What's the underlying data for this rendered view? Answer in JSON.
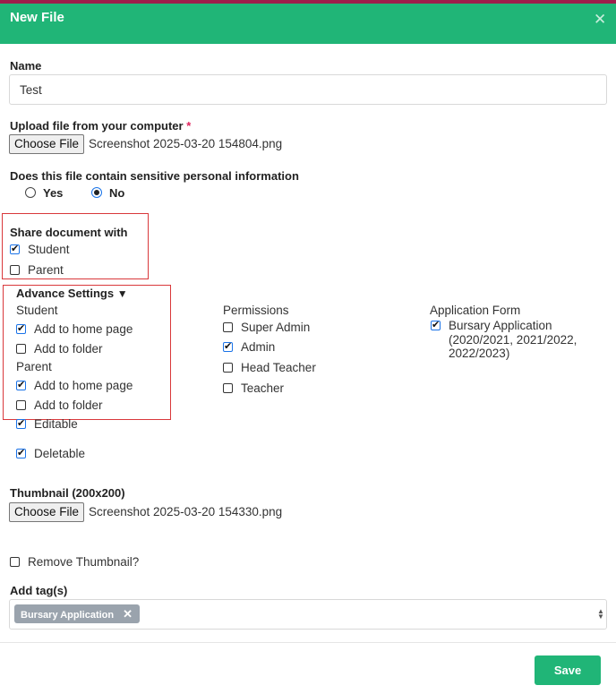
{
  "dialog": {
    "title": "New File",
    "close_glyph": "✕"
  },
  "name_field": {
    "label": "Name",
    "value": "Test"
  },
  "upload": {
    "label": "Upload file from your computer",
    "required_mark": "*",
    "button": "Choose File",
    "filename": "Screenshot 2025-03-20 154804.png"
  },
  "sensitive": {
    "question": "Does this file contain sensitive personal information",
    "yes": "Yes",
    "no": "No",
    "selected": "No"
  },
  "share": {
    "title": "Share document with",
    "student": "Student",
    "student_checked": true,
    "parent": "Parent",
    "parent_checked": false
  },
  "advance": {
    "title": "Advance Settings",
    "toggle_glyph": "▼",
    "student_heading": "Student",
    "student_home": "Add to home page",
    "student_folder": "Add to folder",
    "parent_heading": "Parent",
    "parent_home": "Add to home page",
    "parent_folder": "Add to folder",
    "editable": "Editable",
    "deletable": "Deletable"
  },
  "permissions": {
    "heading": "Permissions",
    "super_admin": "Super Admin",
    "admin": "Admin",
    "head_teacher": "Head Teacher",
    "teacher": "Teacher"
  },
  "application_form": {
    "heading": "Application Form",
    "item_line1": "Bursary Application",
    "item_line2": "(2020/2021, 2021/2022,",
    "item_line3": "2022/2023)"
  },
  "thumbnail": {
    "label": "Thumbnail (200x200)",
    "button": "Choose File",
    "filename": "Screenshot 2025-03-20 154330.png",
    "remove": "Remove Thumbnail?"
  },
  "tags": {
    "label": "Add tag(s)",
    "items": [
      "Bursary Application"
    ],
    "remove_glyph": "✕"
  },
  "footer": {
    "save": "Save"
  },
  "colors": {
    "brand": "#20b577",
    "top_accent": "#9d1e4b",
    "highlight_box": "#d9383b"
  }
}
